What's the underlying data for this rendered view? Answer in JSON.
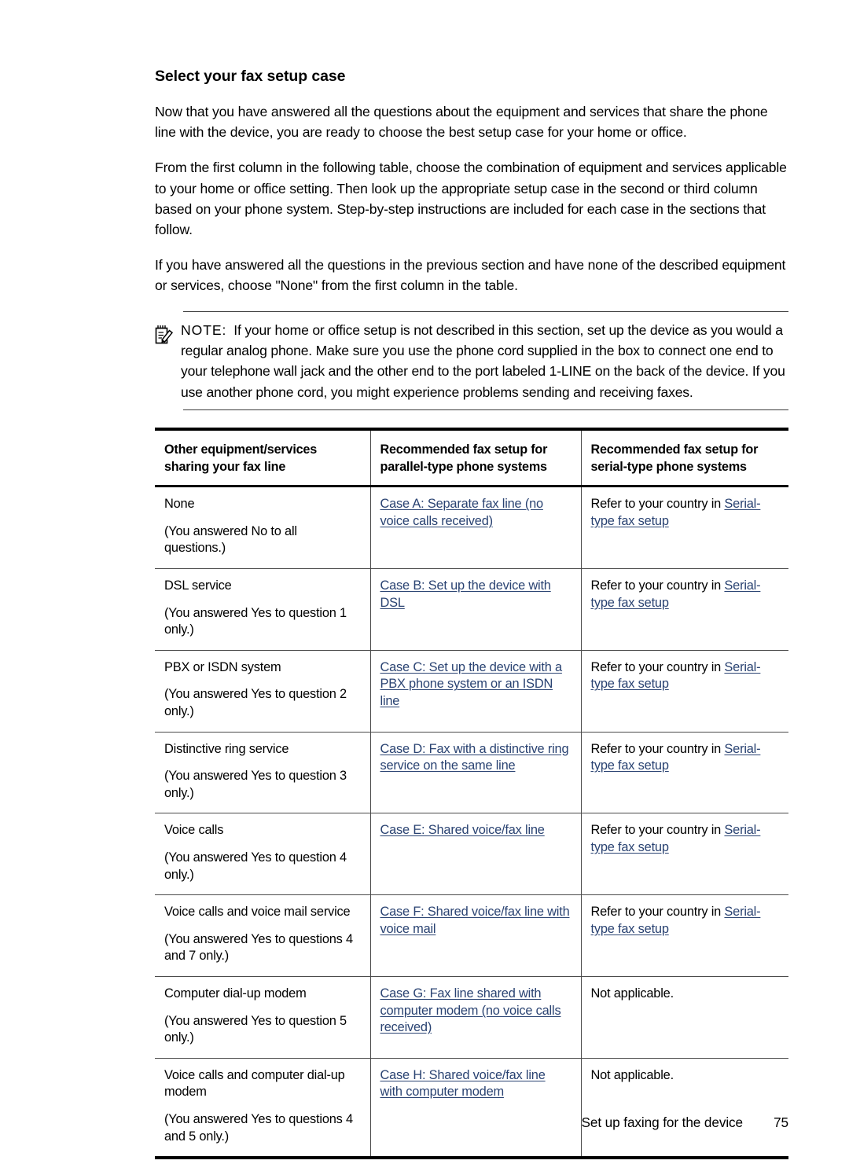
{
  "page": {
    "title": "Select your fax setup case",
    "paragraphs": [
      "Now that you have answered all the questions about the equipment and services that share the phone line with the device, you are ready to choose the best setup case for your home or office.",
      "From the first column in the following table, choose the combination of equipment and services applicable to your home or office setting. Then look up the appropriate setup case in the second or third column based on your phone system. Step-by-step instructions are included for each case in the sections that follow.",
      "If you have answered all the questions in the previous section and have none of the described equipment or services, choose \"None\" from the first column in the table."
    ]
  },
  "note": {
    "icon": "note-pencil-icon",
    "label": "NOTE:",
    "text": "If your home or office setup is not described in this section, set up the device as you would a regular analog phone. Make sure you use the phone cord supplied in the box to connect one end to your telephone wall jack and the other end to the port labeled 1-LINE on the back of the device. If you use another phone cord, you might experience problems sending and receiving faxes."
  },
  "table": {
    "headers": [
      "Other equipment/services sharing your fax line",
      "Recommended fax setup for parallel-type phone systems",
      "Recommended fax setup for serial-type phone systems"
    ],
    "serial_prefix": "Refer to your country in ",
    "serial_link": "Serial-type fax setup",
    "not_applicable": "Not applicable.",
    "rows": [
      {
        "equipment": "None",
        "answer": "(You answered No to all questions.)",
        "parallel_link": "Case A: Separate fax line (no voice calls received)",
        "serial_type": "link"
      },
      {
        "equipment": "DSL service",
        "answer": "(You answered Yes to question 1 only.)",
        "parallel_link": "Case B: Set up the device with DSL",
        "serial_type": "link"
      },
      {
        "equipment": "PBX or ISDN system",
        "answer": "(You answered Yes to question 2 only.)",
        "parallel_link": "Case C: Set up the device with a PBX phone system or an ISDN line",
        "serial_type": "link"
      },
      {
        "equipment": "Distinctive ring service",
        "answer": "(You answered Yes to question 3 only.)",
        "parallel_link": "Case D: Fax with a distinctive ring service on the same line",
        "serial_type": "link"
      },
      {
        "equipment": "Voice calls",
        "answer": "(You answered Yes to question 4 only.)",
        "parallel_link": "Case E: Shared voice/fax line",
        "serial_type": "link"
      },
      {
        "equipment": "Voice calls and voice mail service",
        "answer": "(You answered Yes to questions 4 and 7 only.)",
        "parallel_link": "Case F: Shared voice/fax line with voice mail",
        "serial_type": "link"
      },
      {
        "equipment": "Computer dial-up modem",
        "answer": "(You answered Yes to question 5 only.)",
        "parallel_link": "Case G: Fax line shared with computer modem (no voice calls received)",
        "serial_type": "text"
      },
      {
        "equipment": "Voice calls and computer dial-up modem",
        "answer": "(You answered Yes to questions 4 and 5 only.)",
        "parallel_link": "Case H: Shared voice/fax line with computer modem",
        "serial_type": "text"
      }
    ]
  },
  "footer": {
    "title": "Set up faxing for the device",
    "page_number": "75"
  }
}
